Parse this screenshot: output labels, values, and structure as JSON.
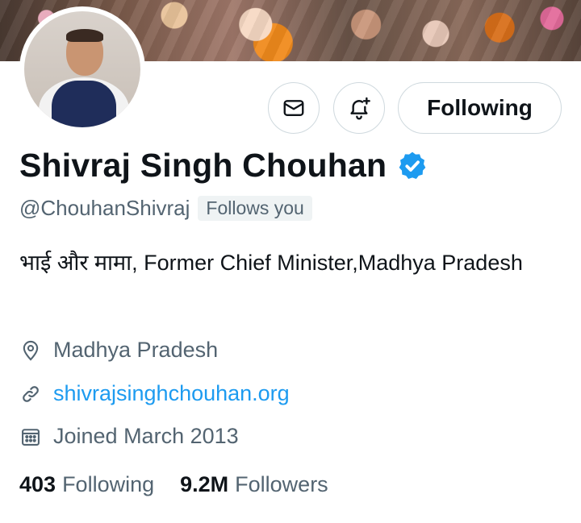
{
  "profile": {
    "name": "Shivraj Singh Chouhan",
    "handle": "@ChouhanShivraj",
    "follows_you": "Follows you",
    "bio": "भाई और मामा, Former Chief Minister,Madhya Pradesh",
    "location": "Madhya Pradesh",
    "website": "shivrajsinghchouhan.org",
    "joined": "Joined March 2013"
  },
  "actions": {
    "following_label": "Following",
    "message_icon": "envelope-icon",
    "notify_icon": "bell-plus-icon"
  },
  "stats": {
    "following_count": "403",
    "following_label": "Following",
    "followers_count": "9.2M",
    "followers_label": "Followers"
  },
  "colors": {
    "verified": "#1d9bf0",
    "link": "#1d9bf0",
    "secondary_text": "#536471"
  }
}
